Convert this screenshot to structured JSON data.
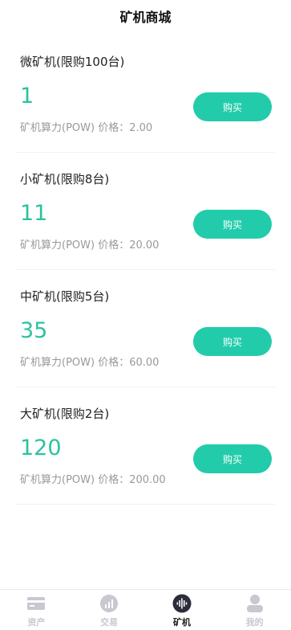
{
  "header": {
    "title": "矿机商城"
  },
  "products": [
    {
      "title": "微矿机(限购100台)",
      "power": "1",
      "price_text": "矿机算力(POW) 价格：2.00",
      "button_label": "购买"
    },
    {
      "title": "小矿机(限购8台)",
      "power": "11",
      "price_text": "矿机算力(POW) 价格：20.00",
      "button_label": "购买"
    },
    {
      "title": "中矿机(限购5台)",
      "power": "35",
      "price_text": "矿机算力(POW) 价格：60.00",
      "button_label": "购买"
    },
    {
      "title": "大矿机(限购2台)",
      "power": "120",
      "price_text": "矿机算力(POW) 价格：200.00",
      "button_label": "购买"
    }
  ],
  "tabbar": {
    "items": [
      {
        "label": "资产",
        "icon": "wallet-icon",
        "active": false
      },
      {
        "label": "交易",
        "icon": "chart-icon",
        "active": false
      },
      {
        "label": "矿机",
        "icon": "waveform-icon",
        "active": true
      },
      {
        "label": "我的",
        "icon": "user-icon",
        "active": false
      }
    ]
  },
  "colors": {
    "accent": "#22ccaa",
    "power_text": "#2bc2a0",
    "tab_inactive": "#c8c8d0",
    "tab_active": "#2c2c3a"
  }
}
